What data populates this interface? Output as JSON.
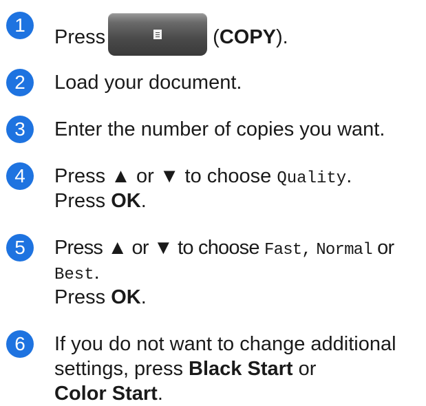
{
  "steps": [
    {
      "number": "1",
      "press": "Press",
      "key_label": "COPY"
    },
    {
      "number": "2",
      "text": "Load your document."
    },
    {
      "number": "3",
      "text": "Enter the number of copies you want."
    },
    {
      "number": "4",
      "line1_prefix": "Press ▲ or ▼ to choose",
      "option": "Quality",
      "line2_prefix": "Press",
      "ok_label": "OK"
    },
    {
      "number": "5",
      "line1_prefix": "Press ▲ or ▼ to choose",
      "option_fast": "Fast,",
      "option_normal": "Normal",
      "or_word": "or",
      "option_best": "Best",
      "line3_prefix": "Press",
      "ok_label": "OK"
    },
    {
      "number": "6",
      "line1": "If you do not want to change additional",
      "line2_prefix": "settings, press",
      "black_start": "Black Start",
      "or_word": "or",
      "color_start": "Color Start"
    }
  ],
  "icons": {
    "copy_key": "copy-icon"
  },
  "colors": {
    "step_badge": "#1e73e0",
    "key_face": "#4a4a4a"
  }
}
